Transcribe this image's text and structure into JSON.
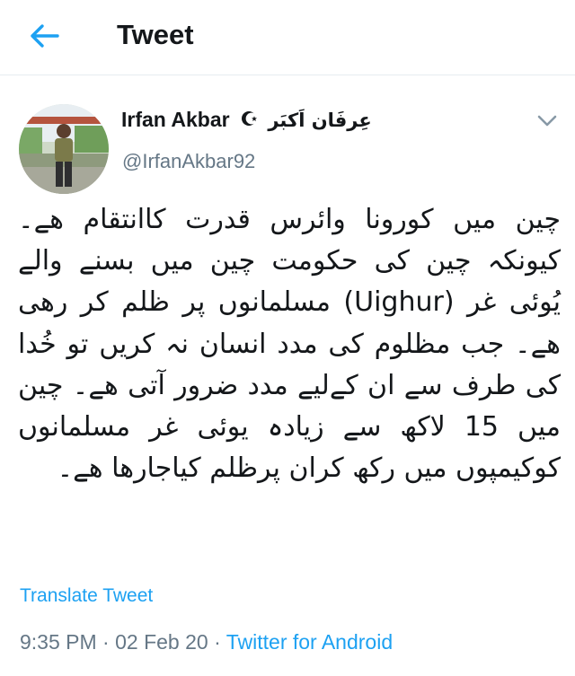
{
  "header": {
    "title": "Tweet",
    "back_icon": "arrow-left-icon"
  },
  "author": {
    "name": "Irfan Akbar",
    "badge_icon": "crescent-star-icon",
    "name_urdu": "عِرفَان اَکبَر",
    "handle": "@IrfanAkbar92",
    "avatar_icon": "user-avatar-photo"
  },
  "tweet": {
    "text": "چین میں کورونا وائرس قدرت کاانتقام ھے۔ کیونکہ چین کی حکومت چین میں بسنے والے یُوئی غر (Uighur) مسلمانوں پر ظلم کر رھی ھے۔ جب مظلوم کی مدد انسان نہ کریں تو خُدا کی طرف سے ان کےلیے مدد ضرور آتی ھے۔ چین میں 15 لاکھ سے زیادہ یوئی غر مسلمانوں کوکیمپوں میں رکھ کران پرظلم کیاجارھا ھے۔"
  },
  "translate_label": "Translate Tweet",
  "meta": {
    "time": "9:35 PM",
    "date": "02 Feb 20",
    "separator": "·",
    "source": "Twitter for Android"
  },
  "colors": {
    "accent": "#1da1f2",
    "text": "#14171a",
    "secondary": "#657786",
    "divider": "#e6ecf0"
  }
}
